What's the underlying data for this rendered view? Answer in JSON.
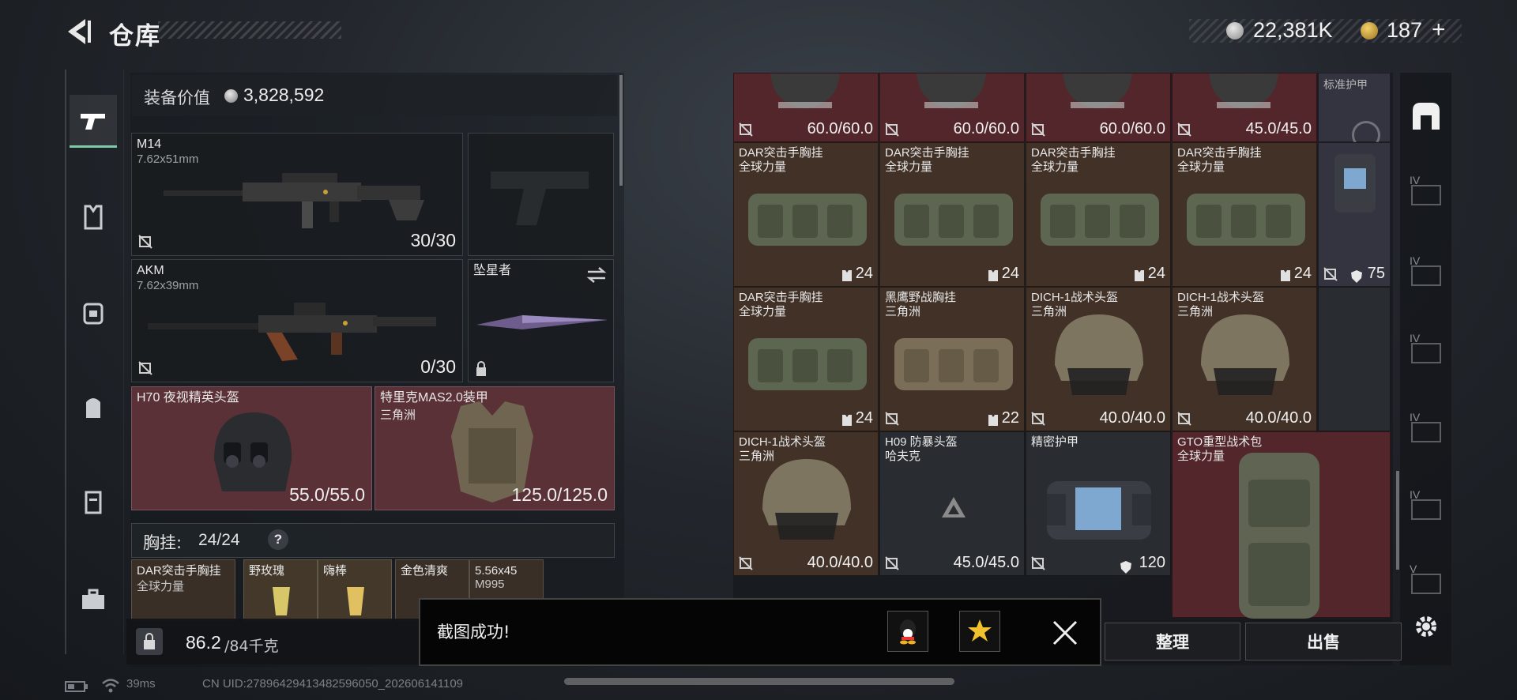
{
  "header": {
    "title": "仓库",
    "currency_amount": "22,381K",
    "gold_amount": "187",
    "add_symbol": "+",
    "currency_color": "#c6c6c6",
    "gold_color": "#c9a034"
  },
  "rail": {
    "tabs": [
      {
        "icon": "pistol-icon",
        "active": true
      },
      {
        "icon": "armor-vest-icon"
      },
      {
        "icon": "chest-rig-icon"
      },
      {
        "icon": "backpack-icon"
      },
      {
        "icon": "container-icon"
      },
      {
        "icon": "briefcase-icon"
      }
    ]
  },
  "loadout": {
    "equipment_value_label": "装备价值",
    "equipment_value": "3,828,592",
    "primary": {
      "name": "M14",
      "caliber": "7.62x51mm",
      "ammo": "30/30"
    },
    "secondary": {
      "name": "AKM",
      "caliber": "7.62x39mm",
      "ammo": "0/30"
    },
    "melee": {
      "name": "坠星者"
    },
    "helmet": {
      "name": "H70 夜视精英头盔",
      "durability": "55.0/55.0"
    },
    "armor": {
      "name": "特里克MAS2.0装甲",
      "faction": "三角洲",
      "durability": "125.0/125.0"
    },
    "rig_label": "胸挂:",
    "rig_capacity": "24/24",
    "rig_help": "?",
    "rig_items": [
      {
        "name": "DAR突击手胸挂",
        "faction": "全球力量"
      },
      {
        "name": "野玫瑰"
      },
      {
        "name": "嗨棒"
      },
      {
        "name": "金色清爽"
      },
      {
        "name": "5.56x45",
        "sub": "M995"
      }
    ],
    "weight": "86.2",
    "weight_limit": "/84千克"
  },
  "grid": {
    "row0": [
      {
        "value": "60.0/60.0"
      },
      {
        "value": "60.0/60.0"
      },
      {
        "value": "60.0/60.0"
      },
      {
        "value": "45.0/45.0"
      }
    ],
    "row0_extra": "标准护甲",
    "row1": [
      {
        "name": "DAR突击手胸挂",
        "faction": "全球力量",
        "value": "24"
      },
      {
        "name": "DAR突击手胸挂",
        "faction": "全球力量",
        "value": "24"
      },
      {
        "name": "DAR突击手胸挂",
        "faction": "全球力量",
        "value": "24"
      },
      {
        "name": "DAR突击手胸挂",
        "faction": "全球力量",
        "value": "24"
      }
    ],
    "row1_extra": {
      "value": "75"
    },
    "row2": [
      {
        "name": "DAR突击手胸挂",
        "faction": "全球力量",
        "value": "24"
      },
      {
        "name": "黑鹰野战胸挂",
        "faction": "三角洲",
        "value": "22"
      },
      {
        "name": "DICH-1战术头盔",
        "faction": "三角洲",
        "value": "40.0/40.0"
      },
      {
        "name": "DICH-1战术头盔",
        "faction": "三角洲",
        "value": "40.0/40.0"
      }
    ],
    "row3": [
      {
        "name": "DICH-1战术头盔",
        "faction": "三角洲",
        "value": "40.0/40.0"
      },
      {
        "name": "H09 防暴头盔",
        "faction": "哈夫克",
        "value": "45.0/45.0"
      },
      {
        "name": "精密护甲",
        "faction": "",
        "value": "120"
      },
      {
        "name": "GTO重型战术包",
        "faction": "全球力量"
      }
    ]
  },
  "right_rail": {
    "tiers": [
      "IV",
      "IV",
      "IV",
      "IV",
      "IV",
      "V"
    ]
  },
  "actions": {
    "sort_label": "整理",
    "sell_label": "出售"
  },
  "toast": {
    "message": "截图成功!"
  },
  "status": {
    "ping": "39ms",
    "uid": "CN UID:2789642941348259605​0_202606141109"
  }
}
